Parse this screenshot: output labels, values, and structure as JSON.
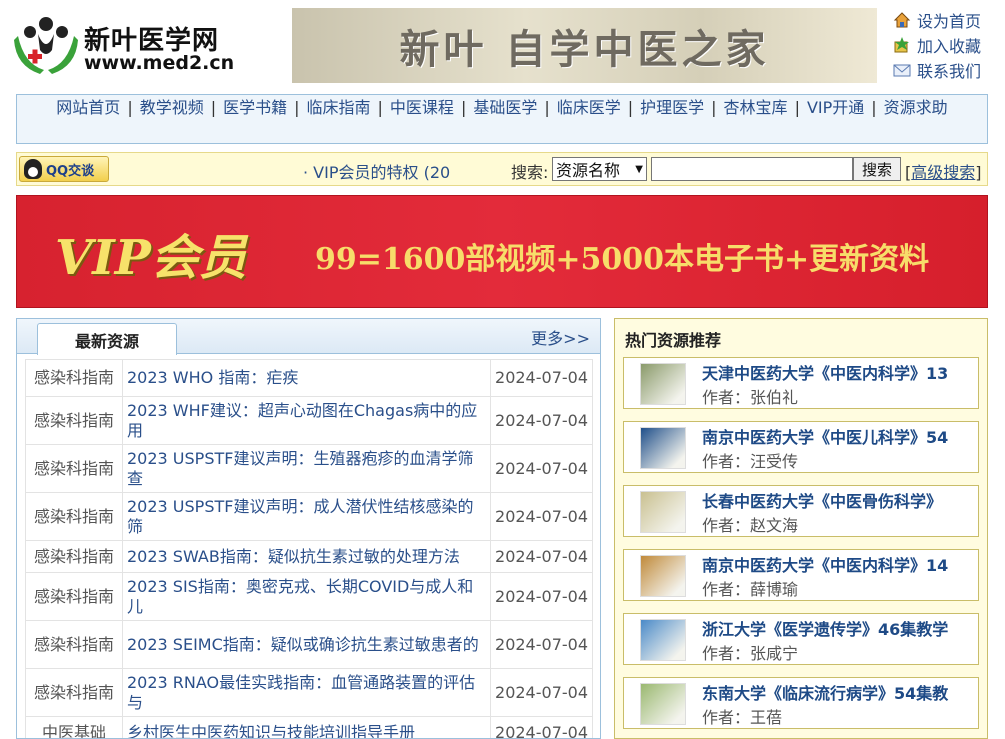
{
  "header": {
    "logo_text": "新叶医学网",
    "logo_url": "www.med2.cn",
    "banner_text": "新叶 自学中医之家",
    "quick_links": [
      {
        "label": "设为首页",
        "icon": "home-icon"
      },
      {
        "label": "加入收藏",
        "icon": "bookmark-icon"
      },
      {
        "label": "联系我们",
        "icon": "mail-icon"
      }
    ]
  },
  "nav": {
    "items": [
      "网站首页",
      "教学视频",
      "医学书籍",
      "临床指南",
      "中医课程",
      "基础医学",
      "临床医学",
      "护理医学",
      "杏林宝库",
      "VIP开通",
      "资源求助"
    ]
  },
  "searchbar": {
    "qq_label": "QQ交谈",
    "vip_notice": "· VIP会员的特权 (20",
    "search_label": "搜索:",
    "select_value": "资源名称",
    "input_value": "",
    "search_button": "搜索",
    "adv_open": "[",
    "adv_label": "高级搜索",
    "adv_close": "]"
  },
  "vip_banner": {
    "title": "VIP会员",
    "desc": "99=1600部视频+5000本电子书+更新资料"
  },
  "latest": {
    "tab_label": "最新资源",
    "more_label": "更多>>",
    "rows": [
      {
        "category": "感染科指南",
        "title": "2023 WHO 指南：疟疾",
        "date": "2024-07-04"
      },
      {
        "category": "感染科指南",
        "title": "2023 WHF建议：超声心动图在Chagas病中的应用",
        "date": "2024-07-04"
      },
      {
        "category": "感染科指南",
        "title": "2023 USPSTF建议声明：生殖器疱疹的血清学筛查",
        "date": "2024-07-04"
      },
      {
        "category": "感染科指南",
        "title": "2023 USPSTF建议声明：成人潜伏性结核感染的筛",
        "date": "2024-07-04"
      },
      {
        "category": "感染科指南",
        "title": "2023 SWAB指南：疑似抗生素过敏的处理方法",
        "date": "2024-07-04"
      },
      {
        "category": "感染科指南",
        "title": "2023 SIS指南：奥密克戎、长期COVID与成人和儿",
        "date": "2024-07-04"
      },
      {
        "category": "感染科指南",
        "title": "2023 SEIMC指南：疑似或确诊抗生素过敏患者的",
        "date": "2024-07-04"
      },
      {
        "category": "感染科指南",
        "title": "2023 RNAO最佳实践指南：血管通路装置的评估与",
        "date": "2024-07-04"
      },
      {
        "category": "中医基础",
        "title": "乡村医生中医药知识与技能培训指导手册",
        "date": "2024-07-04"
      }
    ]
  },
  "hot": {
    "title": "热门资源推荐",
    "items": [
      {
        "name": "天津中医药大学《中医内科学》13",
        "author_label": "作者：",
        "author": "张伯礼",
        "thumb_color": "#8a9a6a"
      },
      {
        "name": "南京中医药大学《中医儿科学》54",
        "author_label": "作者：",
        "author": "汪受传",
        "thumb_color": "#1f4f8a"
      },
      {
        "name": "长春中医药大学《中医骨伤科学》",
        "author_label": "作者：",
        "author": "赵文海",
        "thumb_color": "#c9c090"
      },
      {
        "name": "南京中医药大学《中医内科学》14",
        "author_label": "作者：",
        "author": "薛博瑜",
        "thumb_color": "#c08a3a"
      },
      {
        "name": "浙江大学《医学遗传学》46集教学",
        "author_label": "作者：",
        "author": "张咸宁",
        "thumb_color": "#4a8ac8"
      },
      {
        "name": "东南大学《临床流行病学》54集教",
        "author_label": "作者：",
        "author": "王蓓",
        "thumb_color": "#9ab870"
      }
    ]
  }
}
